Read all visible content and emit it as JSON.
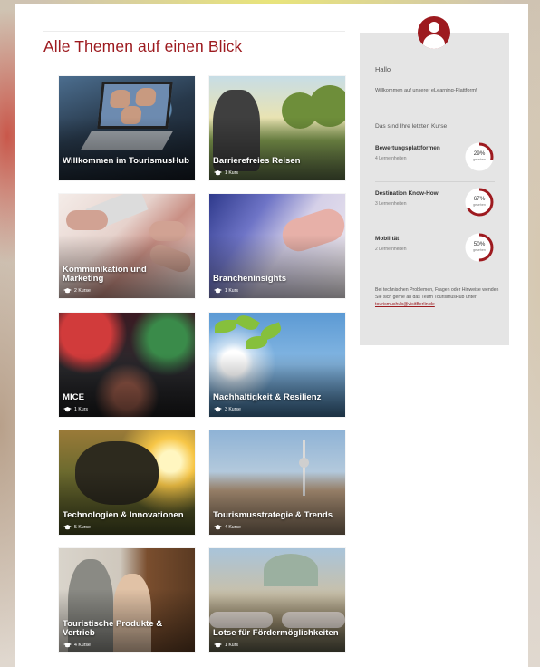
{
  "page": {
    "title": "Alle Themen auf einen Blick"
  },
  "topics": [
    {
      "title": "Willkommen im TourismusHub",
      "count": ""
    },
    {
      "title": "Barrierefreies Reisen",
      "count": "1 Kurs"
    },
    {
      "title": "Kommunikation und Marketing",
      "count": "2 Kurse"
    },
    {
      "title": "Brancheninsights",
      "count": "1 Kurs"
    },
    {
      "title": "MICE",
      "count": "1 Kurs"
    },
    {
      "title": "Nachhaltigkeit & Resilienz",
      "count": "3 Kurse"
    },
    {
      "title": "Technologien & Innovationen",
      "count": "5 Kurse"
    },
    {
      "title": "Tourismusstrategie & Trends",
      "count": "4 Kurse"
    },
    {
      "title": "Touristische Produkte & Vertrieb",
      "count": "4 Kurse"
    },
    {
      "title": "Lotse für Fördermöglichkeiten",
      "count": "1 Kurs"
    }
  ],
  "sidebar": {
    "greeting": "Hallo",
    "welcome": "Willkommen auf unserer eLearning-Plattform!",
    "recent_heading": "Das sind Ihre letzten Kurse",
    "courses": [
      {
        "name": "Bewertungsplattformen",
        "sub": "4 Lerneinheiten",
        "percent": "29%",
        "progress": 0.29,
        "progress_label": "gesehen"
      },
      {
        "name": "Destination Know-How",
        "sub": "3 Lerneinheiten",
        "percent": "67%",
        "progress": 0.67,
        "progress_label": "gesehen"
      },
      {
        "name": "Mobilität",
        "sub": "2 Lerneinheiten",
        "percent": "50%",
        "progress": 0.5,
        "progress_label": "gesehen"
      }
    ],
    "help_text": "Bei technischen Problemen, Fragen oder Hinweise wenden Sie sich gerne an das Team TourismusHub unter:",
    "help_email": "tourismushub@visitBerlin.de"
  },
  "colors": {
    "accent": "#9d1a1f",
    "ring_track": "#ffffff",
    "sidebar_bg": "#e5e5e5"
  },
  "icons": {
    "course_count": "graduation-cap-icon",
    "avatar": "user-avatar-icon"
  }
}
